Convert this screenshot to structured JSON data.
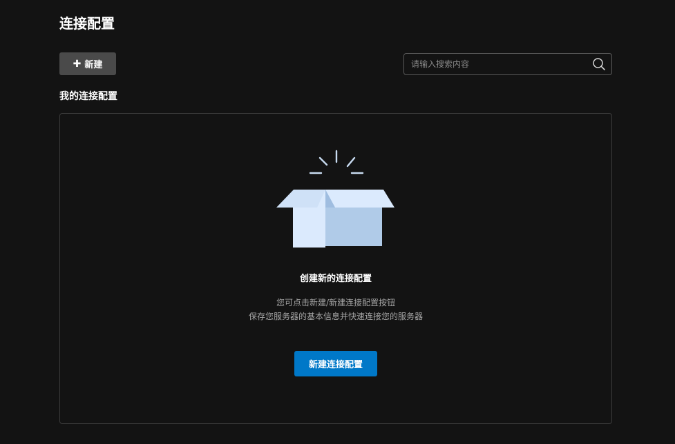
{
  "page": {
    "title": "连接配置"
  },
  "toolbar": {
    "new_label": "新建",
    "new_icon": "plus-icon"
  },
  "search": {
    "placeholder": "请输入搜索内容",
    "value": "",
    "icon": "search-icon"
  },
  "section": {
    "title": "我的连接配置"
  },
  "empty_state": {
    "illustration": "open-box-icon",
    "title": "创建新的连接配置",
    "description_line1": "您可点击新建/新建连接配置按钮",
    "description_line2": "保存您服务器的基本信息并快速连接您的服务器",
    "button_label": "新建连接配置"
  },
  "colors": {
    "background": "#131313",
    "primary": "#0078c8",
    "secondary_button": "#4a4a4a",
    "box_light": "#dbeafd",
    "box_dark": "#b0cbe8"
  }
}
